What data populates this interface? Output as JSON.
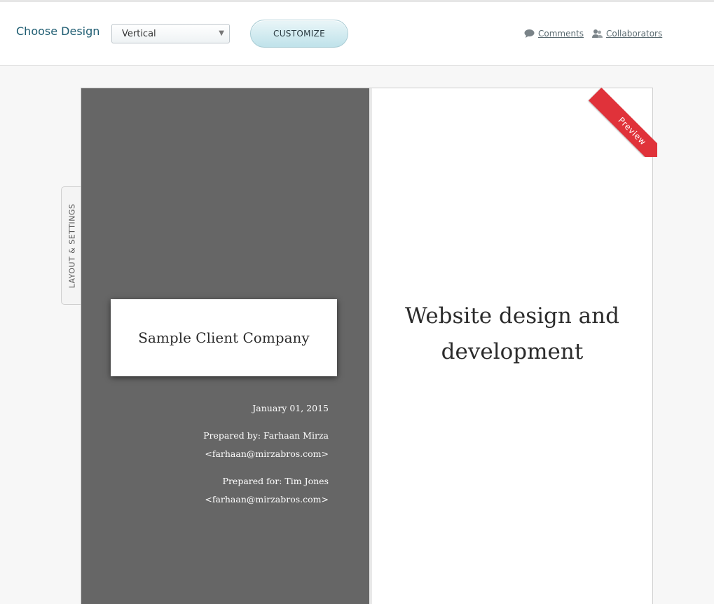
{
  "header": {
    "choose_design_label": "Choose Design",
    "design_select": {
      "value": "Vertical"
    },
    "customize_label": "CUSTOMIZE",
    "comments_label": "Comments",
    "collaborators_label": "Collaborators"
  },
  "side_tab": {
    "label": "LAYOUT &  SETTINGS"
  },
  "document": {
    "ribbon_label": "Preview",
    "company": "Sample Client Company",
    "date": "January 01, 2015",
    "prepared_by": "Prepared by: Farhaan Mirza",
    "prepared_by_email": "<farhaan@mirzabros.com>",
    "prepared_for": "Prepared for: Tim Jones",
    "prepared_for_email": "<farhaan@mirzabros.com>",
    "title": "Website design and development"
  },
  "colors": {
    "accent": "#1f5d72",
    "ribbon": "#e0323a",
    "cover_panel": "#666666",
    "customize_button": "#bfe2ea"
  },
  "icons": {
    "comments": "speech-bubble-icon",
    "collaborators": "people-icon",
    "select": "chevron-down-icon"
  }
}
